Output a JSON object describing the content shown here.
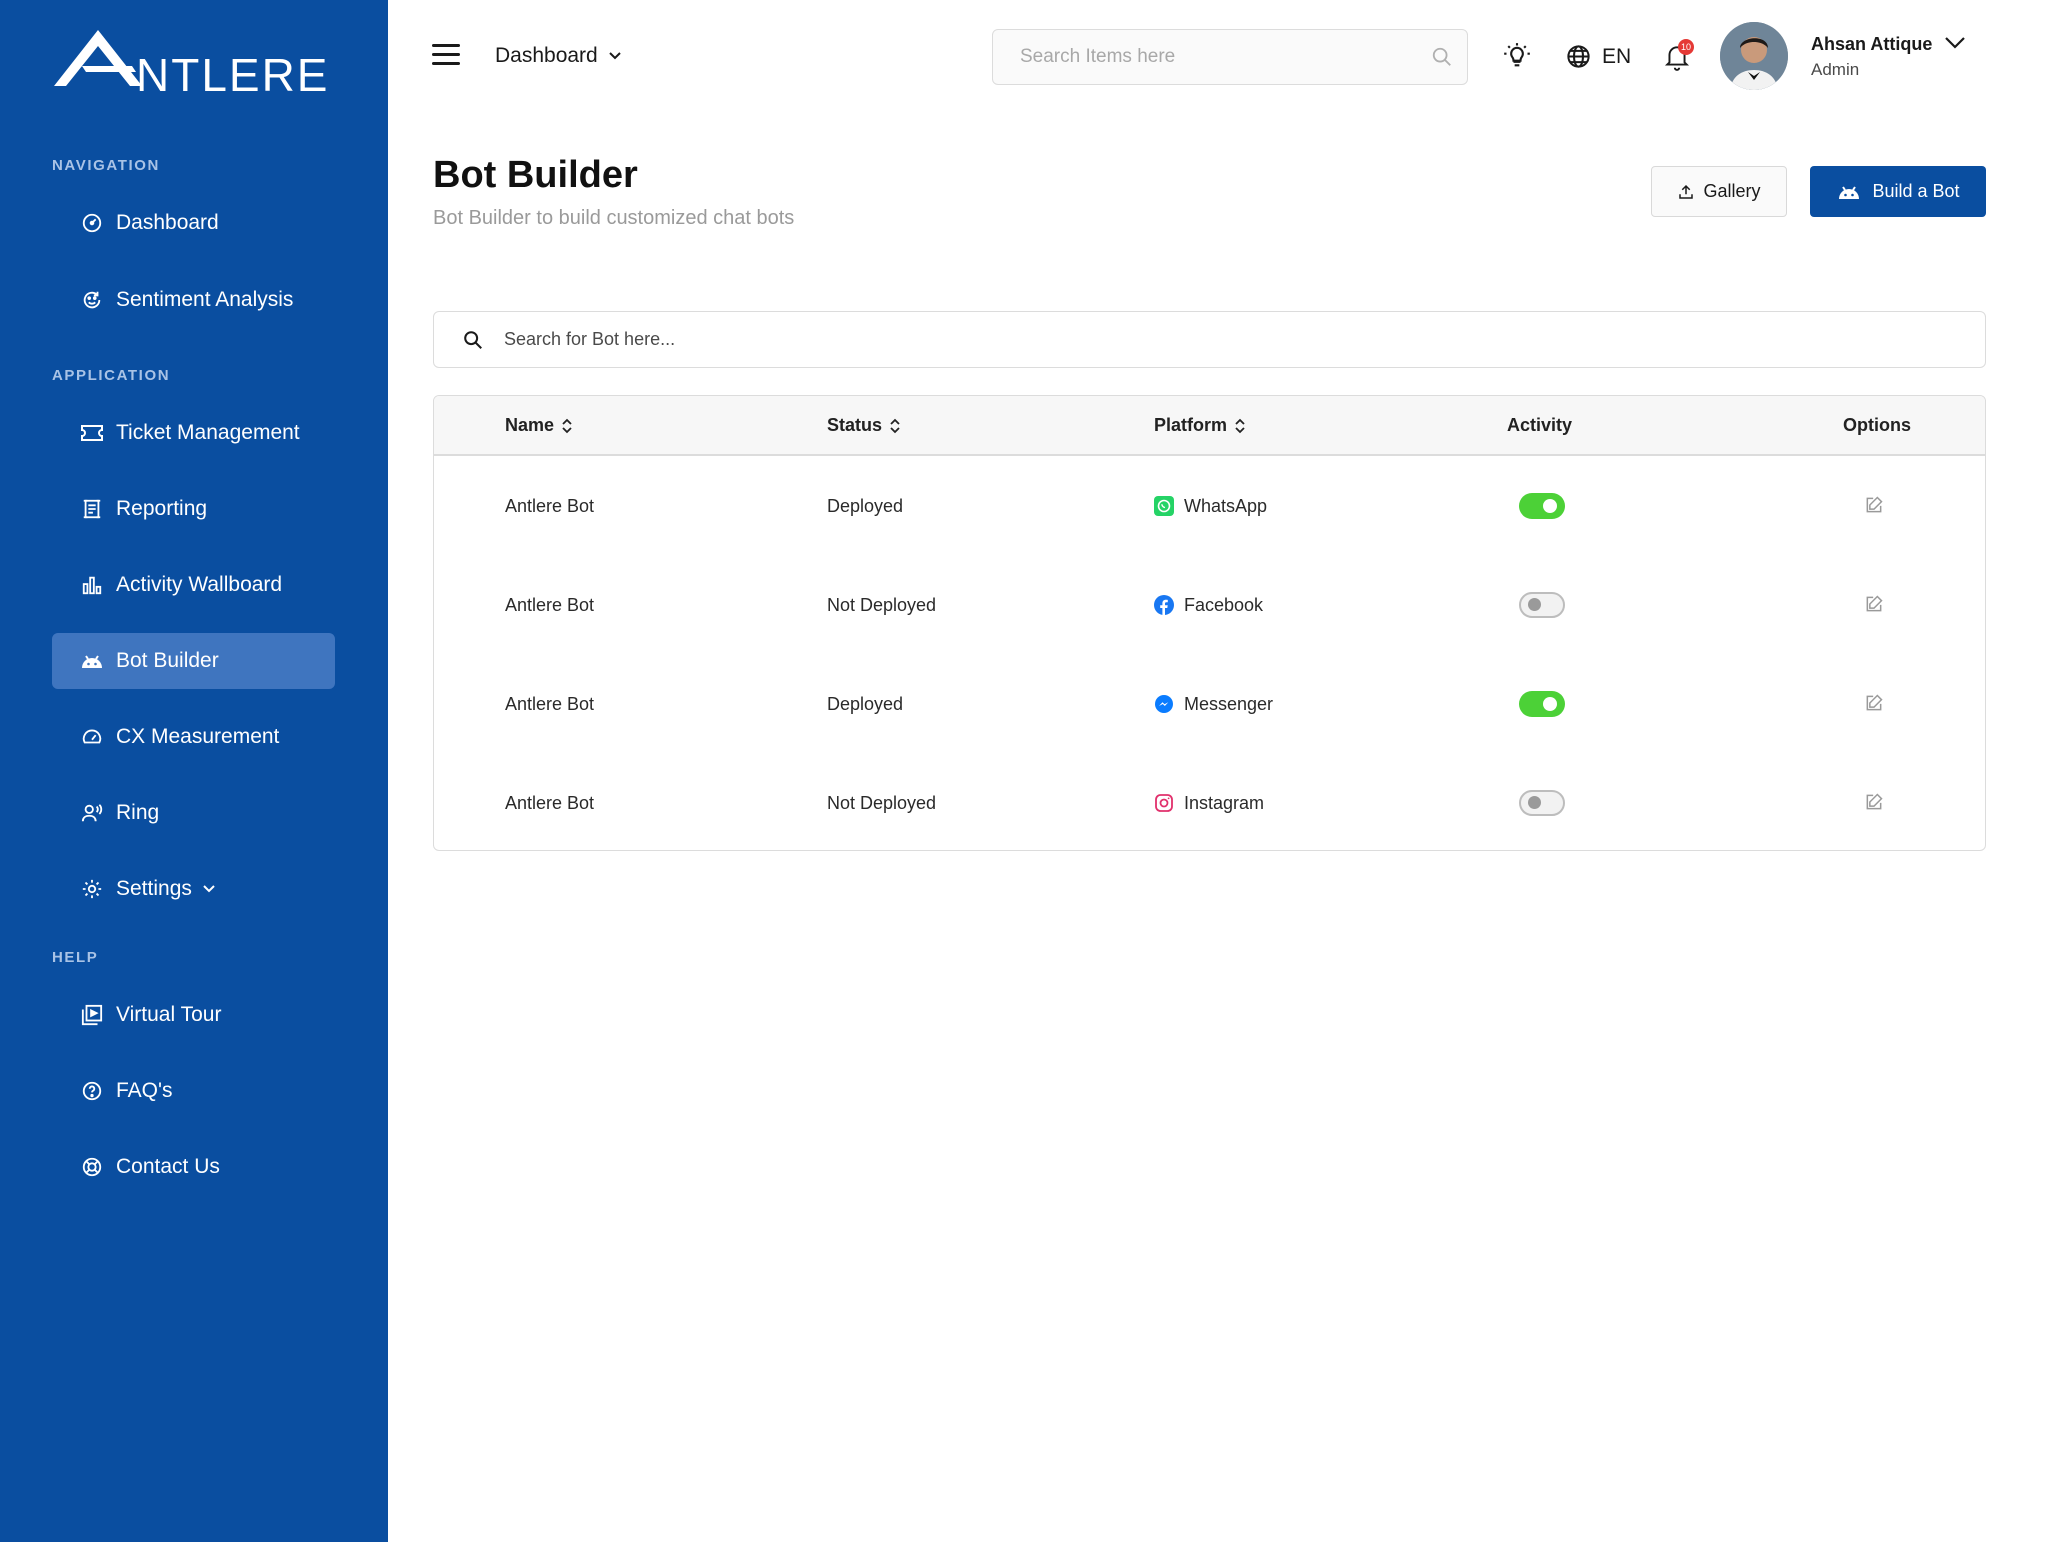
{
  "brand": {
    "logo_text": "NTLERE"
  },
  "sidebar": {
    "sections": {
      "navigation": "NAVIGATION",
      "application": "APPLICATION",
      "help": "HELP"
    },
    "items": [
      {
        "label": "Dashboard",
        "icon": "speedometer-icon"
      },
      {
        "label": "Sentiment Analysis",
        "icon": "smiley-refresh-icon"
      },
      {
        "label": "Ticket Management",
        "icon": "ticket-icon"
      },
      {
        "label": "Reporting",
        "icon": "report-icon"
      },
      {
        "label": "Activity Wallboard",
        "icon": "bar-chart-icon"
      },
      {
        "label": "Bot Builder",
        "icon": "bot-icon",
        "active": true
      },
      {
        "label": "CX Measurement",
        "icon": "gauge-icon"
      },
      {
        "label": "Ring",
        "icon": "ring-icon"
      },
      {
        "label": "Settings",
        "icon": "gear-icon"
      },
      {
        "label": "Virtual Tour",
        "icon": "play-icon"
      },
      {
        "label": "FAQ's",
        "icon": "question-icon"
      },
      {
        "label": "Contact Us",
        "icon": "lifebuoy-icon"
      }
    ]
  },
  "header": {
    "dashboard_label": "Dashboard",
    "search_placeholder": "Search Items here",
    "language": "EN",
    "notification_count": "10",
    "user": {
      "name": "Ahsan Attique",
      "role": "Admin"
    }
  },
  "page": {
    "title": "Bot Builder",
    "subtitle": "Bot Builder to build customized chat bots",
    "gallery_label": "Gallery",
    "build_label": "Build a Bot",
    "bot_search_placeholder": "Search for Bot here..."
  },
  "table": {
    "columns": {
      "name": "Name",
      "status": "Status",
      "platform": "Platform",
      "activity": "Activity",
      "options": "Options"
    },
    "rows": [
      {
        "name": "Antlere Bot",
        "status": "Deployed",
        "platform": "WhatsApp",
        "active": true
      },
      {
        "name": "Antlere Bot",
        "status": "Not Deployed",
        "platform": "Facebook",
        "active": false
      },
      {
        "name": "Antlere Bot",
        "status": "Deployed",
        "platform": "Messenger",
        "active": true
      },
      {
        "name": "Antlere Bot",
        "status": "Not Deployed",
        "platform": "Instagram",
        "active": false
      }
    ]
  },
  "colors": {
    "primary": "#0a4ea0",
    "sidebar_active": "#3f75bf",
    "toggle_on": "#4cd137",
    "whatsapp": "#25d366",
    "facebook": "#1877f2",
    "messenger": "#0a7cff",
    "instagram": "#e1306c"
  }
}
